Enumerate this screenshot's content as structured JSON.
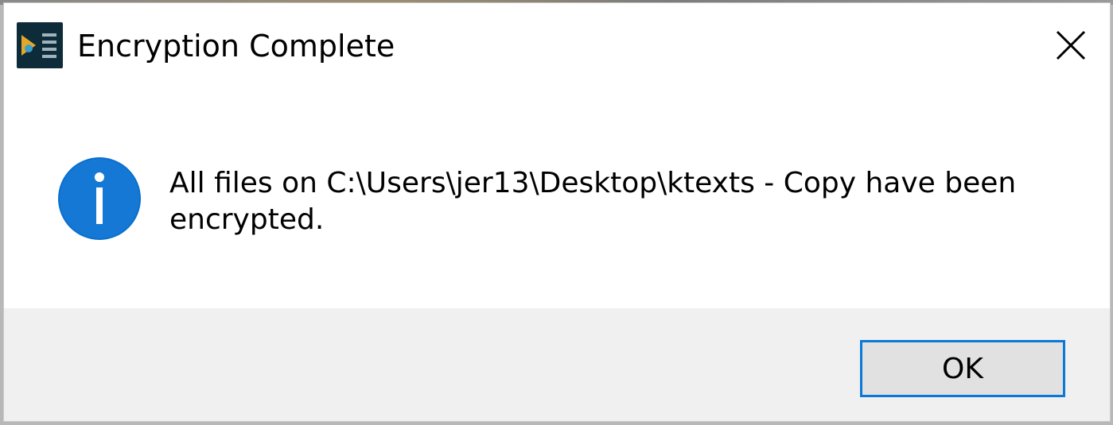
{
  "dialog": {
    "title": "Encryption Complete",
    "app_icon": "app-icon",
    "close_icon": "close-icon"
  },
  "content": {
    "icon": "info-icon",
    "message": "All files on C:\\Users\\jer13\\Desktop\\ktexts - Copy have been encrypted."
  },
  "footer": {
    "ok_label": "OK"
  },
  "colors": {
    "info_blue": "#0a6fce",
    "focus_border": "#0a78d7",
    "footer_background": "#f0f0f0",
    "button_background": "#e1e1e1"
  }
}
